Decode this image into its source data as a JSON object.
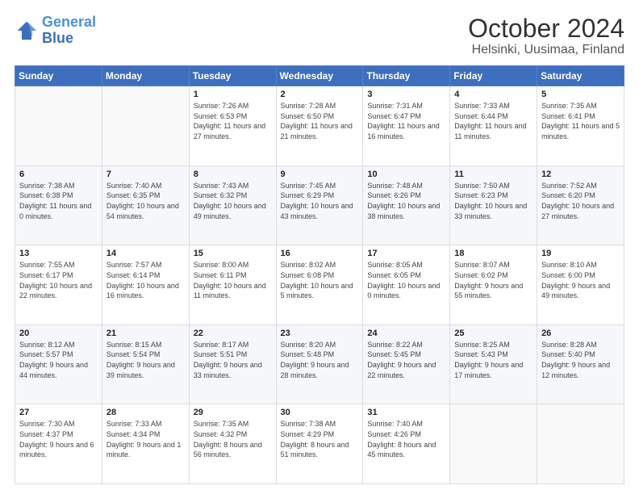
{
  "logo": {
    "line1": "General",
    "line2": "Blue"
  },
  "title": "October 2024",
  "subtitle": "Helsinki, Uusimaa, Finland",
  "days_header": [
    "Sunday",
    "Monday",
    "Tuesday",
    "Wednesday",
    "Thursday",
    "Friday",
    "Saturday"
  ],
  "weeks": [
    [
      {
        "day": "",
        "sunrise": "",
        "sunset": "",
        "daylight": ""
      },
      {
        "day": "",
        "sunrise": "",
        "sunset": "",
        "daylight": ""
      },
      {
        "day": "1",
        "sunrise": "Sunrise: 7:26 AM",
        "sunset": "Sunset: 6:53 PM",
        "daylight": "Daylight: 11 hours and 27 minutes."
      },
      {
        "day": "2",
        "sunrise": "Sunrise: 7:28 AM",
        "sunset": "Sunset: 6:50 PM",
        "daylight": "Daylight: 11 hours and 21 minutes."
      },
      {
        "day": "3",
        "sunrise": "Sunrise: 7:31 AM",
        "sunset": "Sunset: 6:47 PM",
        "daylight": "Daylight: 11 hours and 16 minutes."
      },
      {
        "day": "4",
        "sunrise": "Sunrise: 7:33 AM",
        "sunset": "Sunset: 6:44 PM",
        "daylight": "Daylight: 11 hours and 11 minutes."
      },
      {
        "day": "5",
        "sunrise": "Sunrise: 7:35 AM",
        "sunset": "Sunset: 6:41 PM",
        "daylight": "Daylight: 11 hours and 5 minutes."
      }
    ],
    [
      {
        "day": "6",
        "sunrise": "Sunrise: 7:38 AM",
        "sunset": "Sunset: 6:38 PM",
        "daylight": "Daylight: 11 hours and 0 minutes."
      },
      {
        "day": "7",
        "sunrise": "Sunrise: 7:40 AM",
        "sunset": "Sunset: 6:35 PM",
        "daylight": "Daylight: 10 hours and 54 minutes."
      },
      {
        "day": "8",
        "sunrise": "Sunrise: 7:43 AM",
        "sunset": "Sunset: 6:32 PM",
        "daylight": "Daylight: 10 hours and 49 minutes."
      },
      {
        "day": "9",
        "sunrise": "Sunrise: 7:45 AM",
        "sunset": "Sunset: 6:29 PM",
        "daylight": "Daylight: 10 hours and 43 minutes."
      },
      {
        "day": "10",
        "sunrise": "Sunrise: 7:48 AM",
        "sunset": "Sunset: 6:26 PM",
        "daylight": "Daylight: 10 hours and 38 minutes."
      },
      {
        "day": "11",
        "sunrise": "Sunrise: 7:50 AM",
        "sunset": "Sunset: 6:23 PM",
        "daylight": "Daylight: 10 hours and 33 minutes."
      },
      {
        "day": "12",
        "sunrise": "Sunrise: 7:52 AM",
        "sunset": "Sunset: 6:20 PM",
        "daylight": "Daylight: 10 hours and 27 minutes."
      }
    ],
    [
      {
        "day": "13",
        "sunrise": "Sunrise: 7:55 AM",
        "sunset": "Sunset: 6:17 PM",
        "daylight": "Daylight: 10 hours and 22 minutes."
      },
      {
        "day": "14",
        "sunrise": "Sunrise: 7:57 AM",
        "sunset": "Sunset: 6:14 PM",
        "daylight": "Daylight: 10 hours and 16 minutes."
      },
      {
        "day": "15",
        "sunrise": "Sunrise: 8:00 AM",
        "sunset": "Sunset: 6:11 PM",
        "daylight": "Daylight: 10 hours and 11 minutes."
      },
      {
        "day": "16",
        "sunrise": "Sunrise: 8:02 AM",
        "sunset": "Sunset: 6:08 PM",
        "daylight": "Daylight: 10 hours and 5 minutes."
      },
      {
        "day": "17",
        "sunrise": "Sunrise: 8:05 AM",
        "sunset": "Sunset: 6:05 PM",
        "daylight": "Daylight: 10 hours and 0 minutes."
      },
      {
        "day": "18",
        "sunrise": "Sunrise: 8:07 AM",
        "sunset": "Sunset: 6:02 PM",
        "daylight": "Daylight: 9 hours and 55 minutes."
      },
      {
        "day": "19",
        "sunrise": "Sunrise: 8:10 AM",
        "sunset": "Sunset: 6:00 PM",
        "daylight": "Daylight: 9 hours and 49 minutes."
      }
    ],
    [
      {
        "day": "20",
        "sunrise": "Sunrise: 8:12 AM",
        "sunset": "Sunset: 5:57 PM",
        "daylight": "Daylight: 9 hours and 44 minutes."
      },
      {
        "day": "21",
        "sunrise": "Sunrise: 8:15 AM",
        "sunset": "Sunset: 5:54 PM",
        "daylight": "Daylight: 9 hours and 39 minutes."
      },
      {
        "day": "22",
        "sunrise": "Sunrise: 8:17 AM",
        "sunset": "Sunset: 5:51 PM",
        "daylight": "Daylight: 9 hours and 33 minutes."
      },
      {
        "day": "23",
        "sunrise": "Sunrise: 8:20 AM",
        "sunset": "Sunset: 5:48 PM",
        "daylight": "Daylight: 9 hours and 28 minutes."
      },
      {
        "day": "24",
        "sunrise": "Sunrise: 8:22 AM",
        "sunset": "Sunset: 5:45 PM",
        "daylight": "Daylight: 9 hours and 22 minutes."
      },
      {
        "day": "25",
        "sunrise": "Sunrise: 8:25 AM",
        "sunset": "Sunset: 5:43 PM",
        "daylight": "Daylight: 9 hours and 17 minutes."
      },
      {
        "day": "26",
        "sunrise": "Sunrise: 8:28 AM",
        "sunset": "Sunset: 5:40 PM",
        "daylight": "Daylight: 9 hours and 12 minutes."
      }
    ],
    [
      {
        "day": "27",
        "sunrise": "Sunrise: 7:30 AM",
        "sunset": "Sunset: 4:37 PM",
        "daylight": "Daylight: 9 hours and 6 minutes."
      },
      {
        "day": "28",
        "sunrise": "Sunrise: 7:33 AM",
        "sunset": "Sunset: 4:34 PM",
        "daylight": "Daylight: 9 hours and 1 minute."
      },
      {
        "day": "29",
        "sunrise": "Sunrise: 7:35 AM",
        "sunset": "Sunset: 4:32 PM",
        "daylight": "Daylight: 8 hours and 56 minutes."
      },
      {
        "day": "30",
        "sunrise": "Sunrise: 7:38 AM",
        "sunset": "Sunset: 4:29 PM",
        "daylight": "Daylight: 8 hours and 51 minutes."
      },
      {
        "day": "31",
        "sunrise": "Sunrise: 7:40 AM",
        "sunset": "Sunset: 4:26 PM",
        "daylight": "Daylight: 8 hours and 45 minutes."
      },
      {
        "day": "",
        "sunrise": "",
        "sunset": "",
        "daylight": ""
      },
      {
        "day": "",
        "sunrise": "",
        "sunset": "",
        "daylight": ""
      }
    ]
  ]
}
